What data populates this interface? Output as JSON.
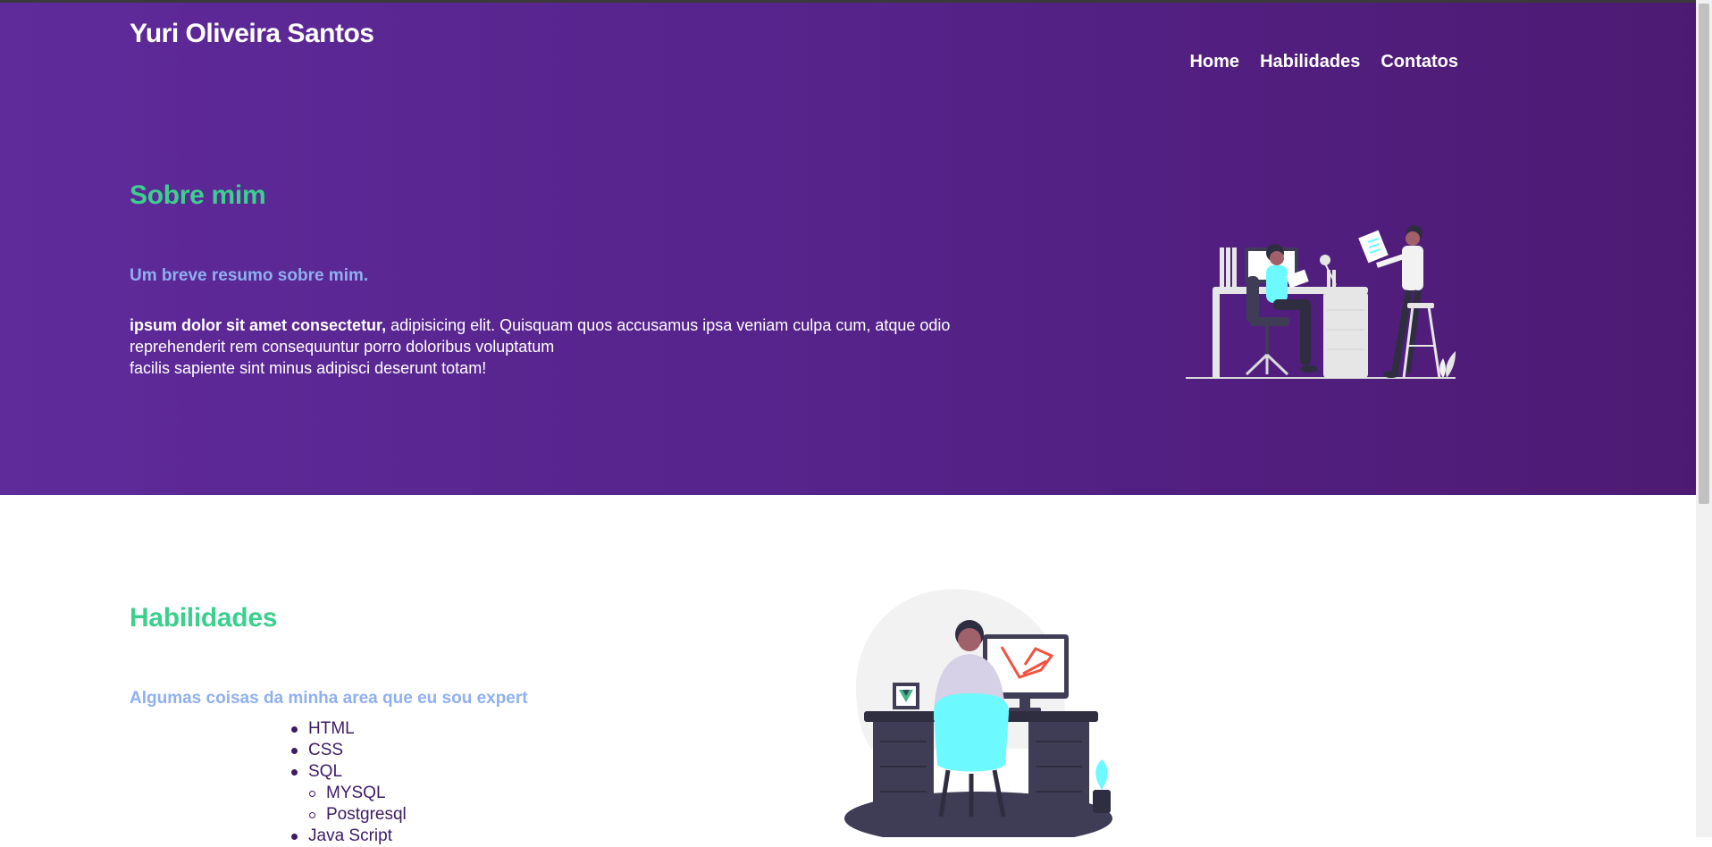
{
  "header": {
    "brand": "Yuri Oliveira Santos",
    "nav": [
      "Home",
      "Habilidades",
      "Contatos"
    ]
  },
  "about": {
    "title": "Sobre mim",
    "subtitle": "Um breve resumo sobre mim.",
    "text_bold": "ipsum dolor sit amet consectetur,",
    "text_line1": " adipisicing elit. Quisquam quos accusamus ipsa veniam culpa cum, atque odio",
    "text_line2": "reprehenderit rem consequuntur porro doloribus voluptatum",
    "text_line3": "facilis sapiente sint minus adipisci deserunt totam!"
  },
  "skills": {
    "title": "Habilidades",
    "subtitle": "Algumas coisas da minha area que eu sou expert",
    "items": [
      "HTML",
      "CSS",
      "SQL",
      "Java Script"
    ],
    "sql_sub": [
      "MYSQL",
      "Postgresql"
    ]
  },
  "icons": {
    "hero_illustration": "people-at-desk-illustration",
    "skills_illustration": "developer-at-computer-illustration"
  },
  "colors": {
    "hero_bg": "#55238a",
    "accent_green": "#3ccf8e",
    "accent_blue": "#8fb0f0",
    "list_text": "#3d1b66"
  }
}
